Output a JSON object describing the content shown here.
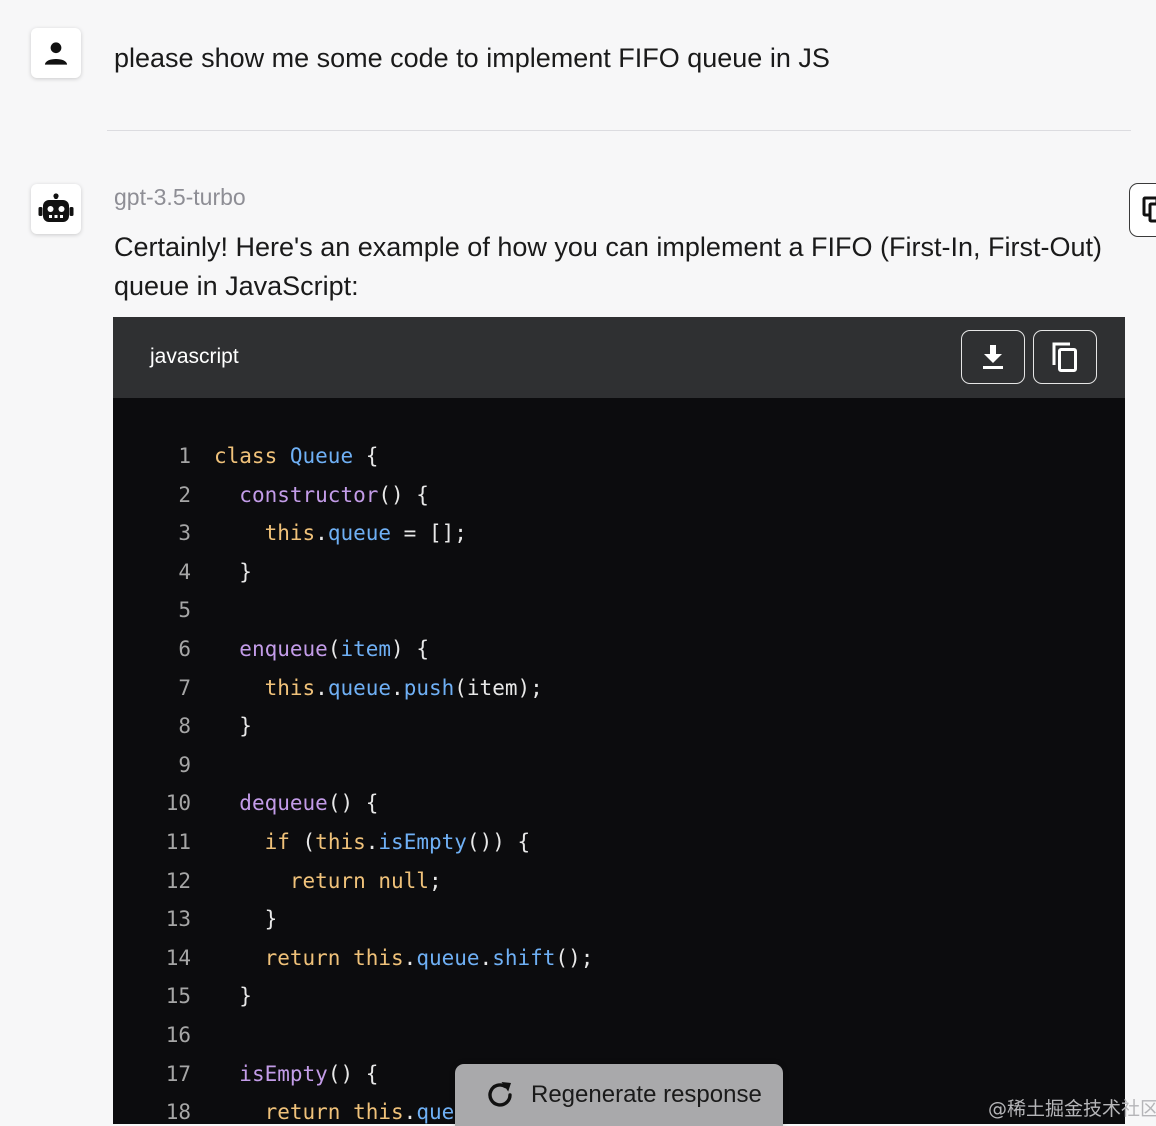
{
  "conversation": {
    "user_message": "please show me some code to implement FIFO queue in JS",
    "model_name": "gpt-3.5-turbo",
    "answer_intro": "Certainly! Here's an example of how you can implement a FIFO (First-In, First-Out) queue in JavaScript:"
  },
  "code_block": {
    "language": "javascript",
    "lines": [
      {
        "n": "1",
        "tokens": [
          {
            "t": "class",
            "c": "kw"
          },
          {
            "t": " "
          },
          {
            "t": "Queue",
            "c": "cls"
          },
          {
            "t": " {"
          }
        ]
      },
      {
        "n": "2",
        "tokens": [
          {
            "t": "  "
          },
          {
            "t": "constructor",
            "c": "fn"
          },
          {
            "t": "() {"
          }
        ]
      },
      {
        "n": "3",
        "tokens": [
          {
            "t": "    "
          },
          {
            "t": "this",
            "c": "kw"
          },
          {
            "t": "."
          },
          {
            "t": "queue",
            "c": "prop"
          },
          {
            "t": " = [];"
          }
        ]
      },
      {
        "n": "4",
        "tokens": [
          {
            "t": "  }"
          }
        ]
      },
      {
        "n": "5",
        "tokens": []
      },
      {
        "n": "6",
        "tokens": [
          {
            "t": "  "
          },
          {
            "t": "enqueue",
            "c": "fn"
          },
          {
            "t": "("
          },
          {
            "t": "item",
            "c": "prop"
          },
          {
            "t": ") {"
          }
        ]
      },
      {
        "n": "7",
        "tokens": [
          {
            "t": "    "
          },
          {
            "t": "this",
            "c": "kw"
          },
          {
            "t": "."
          },
          {
            "t": "queue",
            "c": "prop"
          },
          {
            "t": "."
          },
          {
            "t": "push",
            "c": "prop"
          },
          {
            "t": "(item);"
          }
        ]
      },
      {
        "n": "8",
        "tokens": [
          {
            "t": "  }"
          }
        ]
      },
      {
        "n": "9",
        "tokens": []
      },
      {
        "n": "10",
        "tokens": [
          {
            "t": "  "
          },
          {
            "t": "dequeue",
            "c": "fn"
          },
          {
            "t": "() {"
          }
        ]
      },
      {
        "n": "11",
        "tokens": [
          {
            "t": "    "
          },
          {
            "t": "if",
            "c": "kw"
          },
          {
            "t": " ("
          },
          {
            "t": "this",
            "c": "kw"
          },
          {
            "t": "."
          },
          {
            "t": "isEmpty",
            "c": "prop"
          },
          {
            "t": "()) {"
          }
        ]
      },
      {
        "n": "12",
        "tokens": [
          {
            "t": "      "
          },
          {
            "t": "return",
            "c": "kw"
          },
          {
            "t": " "
          },
          {
            "t": "null",
            "c": "kw"
          },
          {
            "t": ";"
          }
        ]
      },
      {
        "n": "13",
        "tokens": [
          {
            "t": "    }"
          }
        ]
      },
      {
        "n": "14",
        "tokens": [
          {
            "t": "    "
          },
          {
            "t": "return",
            "c": "kw"
          },
          {
            "t": " "
          },
          {
            "t": "this",
            "c": "kw"
          },
          {
            "t": "."
          },
          {
            "t": "queue",
            "c": "prop"
          },
          {
            "t": "."
          },
          {
            "t": "shift",
            "c": "prop"
          },
          {
            "t": "();"
          }
        ]
      },
      {
        "n": "15",
        "tokens": [
          {
            "t": "  }"
          }
        ]
      },
      {
        "n": "16",
        "tokens": []
      },
      {
        "n": "17",
        "tokens": [
          {
            "t": "  "
          },
          {
            "t": "isEmpty",
            "c": "fn"
          },
          {
            "t": "() {"
          }
        ]
      },
      {
        "n": "18",
        "tokens": [
          {
            "t": "    "
          },
          {
            "t": "return",
            "c": "kw"
          },
          {
            "t": " "
          },
          {
            "t": "this",
            "c": "kw"
          },
          {
            "t": "."
          },
          {
            "t": "que",
            "c": "prop"
          }
        ]
      }
    ]
  },
  "regenerate_button": {
    "label": "Regenerate response"
  },
  "watermark": "@稀土掘金技术社区",
  "icons": {
    "user_avatar": "person-icon",
    "bot_avatar": "robot-icon",
    "download": "download-icon",
    "copy": "copy-icon",
    "regenerate": "refresh-icon"
  }
}
